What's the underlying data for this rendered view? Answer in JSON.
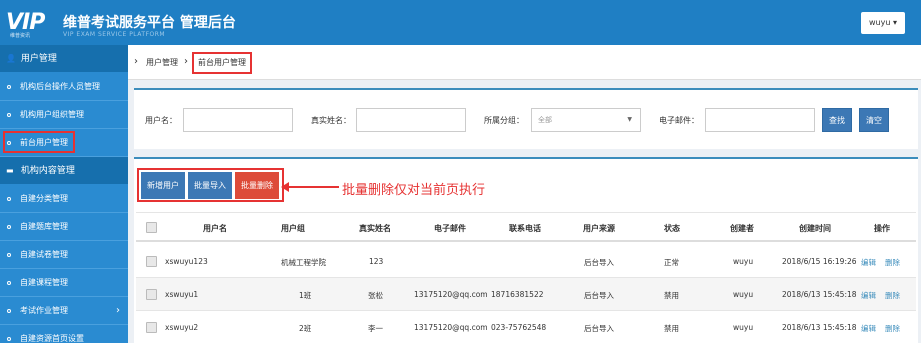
{
  "header": {
    "logo_mark": "VIP",
    "logo_mark_sub": "维普资讯",
    "title": "维普考试服务平台 管理后台",
    "subtitle": "VIP EXAM SERVICE PLATFORM",
    "user_label": "wuyu ▾"
  },
  "sidebar": {
    "groups": [
      {
        "label": "用户管理",
        "icon": "user-icon",
        "items": [
          "机构后台操作人员管理",
          "机构用户组织管理",
          "前台用户管理"
        ]
      },
      {
        "label": "机构内容管理",
        "icon": "folder-icon",
        "items": [
          "自建分类管理",
          "自建题库管理",
          "自建试卷管理",
          "自建课程管理",
          "考试作业管理",
          "自建资源首页设置"
        ]
      }
    ],
    "active_item": "前台用户管理"
  },
  "breadcrumb": {
    "items": [
      "用户管理",
      "前台用户管理"
    ]
  },
  "search": {
    "username_label": "用户名：",
    "realname_label": "真实姓名：",
    "group_label": "所属分组：",
    "group_value": "全部",
    "email_label": "电子邮件：",
    "search_btn": "查找",
    "clear_btn": "清空"
  },
  "toolbar": {
    "add_btn": "新增用户",
    "import_btn": "批量导入",
    "delete_btn": "批量删除",
    "annotation": "批量删除仅对当前页执行",
    "colors": {
      "blue": "#3c78b5",
      "red": "#dd4b39",
      "annotation": "#e63232"
    }
  },
  "table": {
    "headers": [
      "用户名",
      "用户组",
      "真实姓名",
      "电子邮件",
      "联系电话",
      "用户来源",
      "状态",
      "创建者",
      "创建时间",
      "操作"
    ],
    "rows": [
      {
        "username": "xswuyu123",
        "group": "机械工程学院",
        "realname": "123",
        "email": "",
        "phone": "",
        "source": "后台导入",
        "status": "正常",
        "creator": "wuyu",
        "created": "2018/6/15 16:19:26",
        "edit": "编辑",
        "delete": "删除"
      },
      {
        "username": "xswuyu1",
        "group": "1班",
        "realname": "张松",
        "email": "13175120@qq.com",
        "phone": "18716381522",
        "source": "后台导入",
        "status": "禁用",
        "creator": "wuyu",
        "created": "2018/6/13 15:45:18",
        "edit": "编辑",
        "delete": "删除"
      },
      {
        "username": "xswuyu2",
        "group": "2班",
        "realname": "李一",
        "email": "13175120@qq.com",
        "phone": "023-75762548",
        "source": "后台导入",
        "status": "禁用",
        "creator": "wuyu",
        "created": "2018/6/13 15:45:18",
        "edit": "编辑",
        "delete": "删除"
      }
    ]
  }
}
